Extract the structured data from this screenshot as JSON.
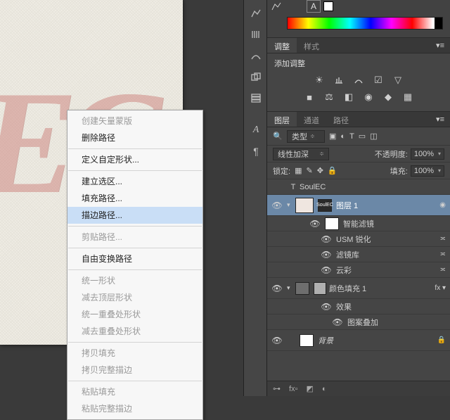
{
  "canvas": {
    "text": "EC"
  },
  "context_menu": {
    "items": [
      {
        "label": "创建矢量蒙版",
        "disabled": true
      },
      {
        "label": "删除路径",
        "disabled": false
      },
      {
        "sep": true
      },
      {
        "label": "定义自定形状...",
        "disabled": false
      },
      {
        "sep": true
      },
      {
        "label": "建立选区...",
        "disabled": false
      },
      {
        "label": "填充路径...",
        "disabled": false
      },
      {
        "label": "描边路径...",
        "disabled": false,
        "highlight": true
      },
      {
        "sep": true
      },
      {
        "label": "剪贴路径...",
        "disabled": true
      },
      {
        "sep": true
      },
      {
        "label": "自由变换路径",
        "disabled": false
      },
      {
        "sep": true
      },
      {
        "label": "统一形状",
        "disabled": true
      },
      {
        "label": "减去顶层形状",
        "disabled": true
      },
      {
        "label": "统一重叠处形状",
        "disabled": true
      },
      {
        "label": "减去重叠处形状",
        "disabled": true
      },
      {
        "sep": true
      },
      {
        "label": "拷贝填充",
        "disabled": true
      },
      {
        "label": "拷贝完整描边",
        "disabled": true
      },
      {
        "sep": true
      },
      {
        "label": "粘贴填充",
        "disabled": true
      },
      {
        "label": "粘贴完整描边",
        "disabled": true
      }
    ]
  },
  "char_panel": {
    "a": "A"
  },
  "adjust_panel": {
    "tabs": [
      "调整",
      "样式"
    ],
    "active": 0,
    "title": "添加调整"
  },
  "layers_panel": {
    "tabs": [
      "图层",
      "通道",
      "路径"
    ],
    "active": 0,
    "filter_label": "类型",
    "blend_mode": "线性加深",
    "opacity_label": "不透明度:",
    "opacity": "100%",
    "lock_label": "锁定:",
    "fill_label": "填充:",
    "fill": "100%",
    "layers": {
      "l0": {
        "name": "SoulEC",
        "type": "T"
      },
      "l1": {
        "name": "图层 1"
      },
      "l1a": {
        "name": "智能滤镜"
      },
      "l1b": {
        "name": "USM 锐化"
      },
      "l1c": {
        "name": "滤镜库"
      },
      "l1d": {
        "name": "云彩"
      },
      "l2": {
        "name": "颜色填充 1"
      },
      "l2a": {
        "name": "效果"
      },
      "l2b": {
        "name": "图案叠加"
      },
      "l3": {
        "name": "背景"
      }
    },
    "ctrl": "≍"
  },
  "bottom": {
    "fx": "fx"
  }
}
